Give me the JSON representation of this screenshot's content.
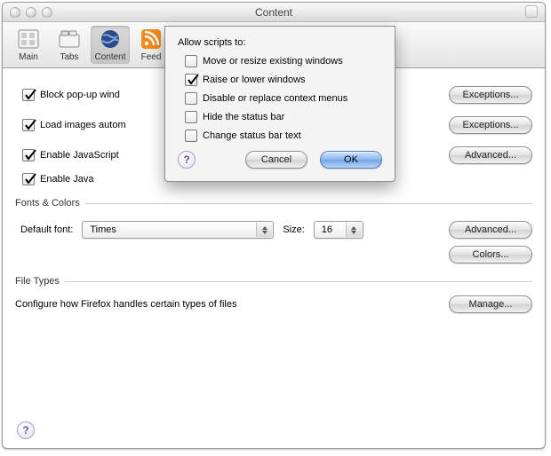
{
  "window": {
    "title": "Content"
  },
  "toolbar": {
    "items": [
      {
        "label": "Main"
      },
      {
        "label": "Tabs"
      },
      {
        "label": "Content"
      },
      {
        "label": "Feed"
      }
    ]
  },
  "content": {
    "block_popups": {
      "checked": true,
      "label": "Block pop-up wind"
    },
    "load_images": {
      "checked": true,
      "label": "Load images autom"
    },
    "enable_js": {
      "checked": true,
      "label": "Enable JavaScript"
    },
    "enable_java": {
      "checked": true,
      "label": "Enable Java"
    }
  },
  "buttons": {
    "exceptions": "Exceptions...",
    "advanced": "Advanced...",
    "colors": "Colors...",
    "manage": "Manage..."
  },
  "fonts": {
    "section_label": "Fonts & Colors",
    "default_font_label": "Default font:",
    "font_value": "Times",
    "size_label": "Size:",
    "size_value": "16"
  },
  "filetypes": {
    "section_label": "File Types",
    "desc": "Configure how Firefox handles certain types of files"
  },
  "dialog": {
    "heading": "Allow scripts to:",
    "opts": [
      {
        "checked": false,
        "label": "Move or resize existing windows"
      },
      {
        "checked": true,
        "label": "Raise or lower windows"
      },
      {
        "checked": false,
        "label": "Disable or replace context menus"
      },
      {
        "checked": false,
        "label": "Hide the status bar"
      },
      {
        "checked": false,
        "label": "Change status bar text"
      }
    ],
    "cancel": "Cancel",
    "ok": "OK"
  },
  "help_glyph": "?"
}
